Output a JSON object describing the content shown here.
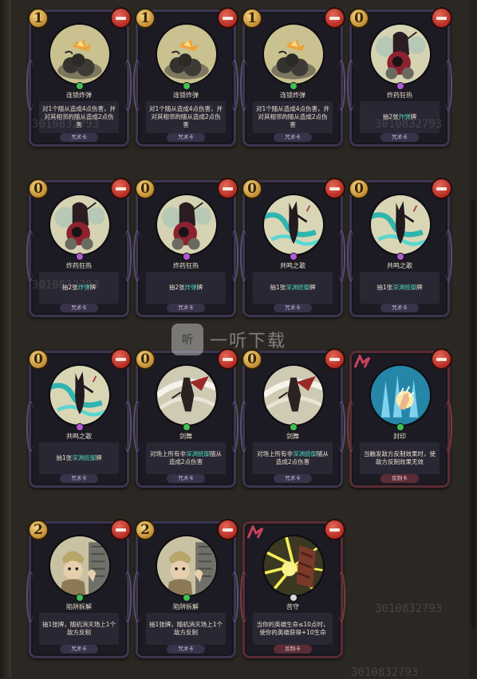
{
  "colors": {
    "skill_gem": "#3fbf55",
    "draw_gem": "#b05ad6",
    "reflect_gem": "#d8d8d8",
    "highlight": "#4fd2b8"
  },
  "watermark": {
    "logo": "听",
    "text": "一听下载",
    "code": "3010832793"
  },
  "cards": [
    {
      "cost": "1",
      "name": "连锁炸弹",
      "art": "bomb",
      "gem": "skill",
      "kind": "spell",
      "desc": [
        {
          "t": "对1个随从造成4点伤害，并对其相邻的随从造成2点伤害"
        }
      ],
      "type": "咒术卡"
    },
    {
      "cost": "1",
      "name": "连锁炸弹",
      "art": "bomb",
      "gem": "skill",
      "kind": "spell",
      "desc": [
        {
          "t": "对1个随从造成4点伤害，并对其相邻的随从造成2点伤害"
        }
      ],
      "type": "咒术卡"
    },
    {
      "cost": "1",
      "name": "连锁炸弹",
      "art": "bomb",
      "gem": "skill",
      "kind": "spell",
      "desc": [
        {
          "t": "对1个随从造成4点伤害，并对其相邻的随从造成2点伤害"
        }
      ],
      "type": "咒术卡"
    },
    {
      "cost": "0",
      "name": "炸药狂热",
      "art": "frenzy",
      "gem": "draw",
      "kind": "spell",
      "desc": [
        {
          "t": "抽2张"
        },
        {
          "t": "炸弹",
          "hl": true
        },
        {
          "t": "牌"
        }
      ],
      "type": "咒术卡"
    },
    {
      "cost": "0",
      "name": "炸药狂热",
      "art": "frenzy",
      "gem": "draw",
      "kind": "spell",
      "desc": [
        {
          "t": "抽2张"
        },
        {
          "t": "炸弹",
          "hl": true
        },
        {
          "t": "牌"
        }
      ],
      "type": "咒术卡"
    },
    {
      "cost": "0",
      "name": "炸药狂热",
      "art": "frenzy",
      "gem": "draw",
      "kind": "spell",
      "desc": [
        {
          "t": "抽2张"
        },
        {
          "t": "炸弹",
          "hl": true
        },
        {
          "t": "牌"
        }
      ],
      "type": "咒术卡"
    },
    {
      "cost": "0",
      "name": "共鸣之歌",
      "art": "song",
      "gem": "draw",
      "kind": "spell",
      "desc": [
        {
          "t": "抽1张"
        },
        {
          "t": "深渊统御",
          "hl": true
        },
        {
          "t": "牌"
        }
      ],
      "type": "咒术卡"
    },
    {
      "cost": "0",
      "name": "共鸣之歌",
      "art": "song",
      "gem": "draw",
      "kind": "spell",
      "desc": [
        {
          "t": "抽1张"
        },
        {
          "t": "深渊统御",
          "hl": true
        },
        {
          "t": "牌"
        }
      ],
      "type": "咒术卡"
    },
    {
      "cost": "0",
      "name": "共鸣之歌",
      "art": "song",
      "gem": "draw",
      "kind": "spell",
      "desc": [
        {
          "t": "抽1张"
        },
        {
          "t": "深渊统御",
          "hl": true
        },
        {
          "t": "牌"
        }
      ],
      "type": "咒术卡"
    },
    {
      "cost": "0",
      "name": "剑舞",
      "art": "sword",
      "gem": "skill",
      "kind": "spell",
      "desc": [
        {
          "t": "对场上所有非"
        },
        {
          "t": "深渊统御",
          "hl": true
        },
        {
          "t": "随从造成2点伤害"
        }
      ],
      "type": "咒术卡"
    },
    {
      "cost": "0",
      "name": "剑舞",
      "art": "sword",
      "gem": "skill",
      "kind": "spell",
      "desc": [
        {
          "t": "对场上所有非"
        },
        {
          "t": "深渊统御",
          "hl": true
        },
        {
          "t": "随从造成2点伤害"
        }
      ],
      "type": "咒术卡"
    },
    {
      "cost": "",
      "name": "封印",
      "art": "seal",
      "gem": "skill",
      "kind": "reflect",
      "desc": [
        {
          "t": "当触发敌方反制效果时，使敌方反制效果无效"
        }
      ],
      "type": "反制卡"
    },
    {
      "cost": "2",
      "name": "陷阱拆解",
      "art": "trap",
      "gem": "skill",
      "kind": "spell",
      "desc": [
        {
          "t": "抽1张牌，随机消灭场上1个敌方反制"
        }
      ],
      "type": "咒术卡"
    },
    {
      "cost": "2",
      "name": "陷阱拆解",
      "art": "trap",
      "gem": "skill",
      "kind": "spell",
      "desc": [
        {
          "t": "抽1张牌，随机消灭场上1个敌方反制"
        }
      ],
      "type": "咒术卡"
    },
    {
      "cost": "",
      "name": "苦守",
      "art": "guard",
      "gem": "reflect",
      "kind": "reflect",
      "desc": [
        {
          "t": "当你的英雄生命≤10点时，使你的英雄获得+10生命"
        }
      ],
      "type": "反制卡"
    }
  ]
}
